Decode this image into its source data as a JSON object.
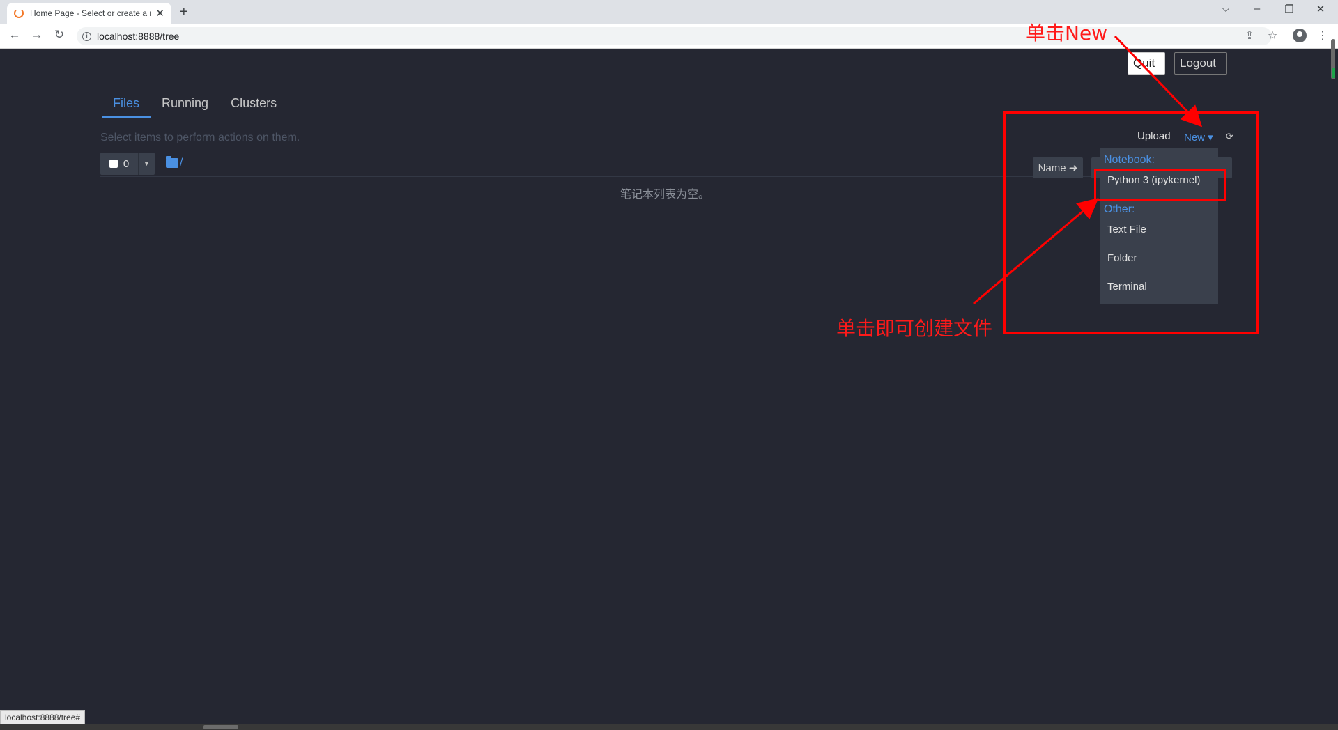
{
  "browser": {
    "tab_title": "Home Page - Select or create a notebook",
    "new_tab_icon": "plus-icon",
    "url": "localhost:8888/tree",
    "status_url": "localhost:8888/tree#"
  },
  "header": {
    "quit_label": "Quit",
    "logout_label": "Logout"
  },
  "tabs": [
    {
      "label": "Files",
      "active": true
    },
    {
      "label": "Running",
      "active": false
    },
    {
      "label": "Clusters",
      "active": false
    }
  ],
  "files": {
    "hint": "Select items to perform actions on them.",
    "selected_count": "0",
    "breadcrumb_sep": "/",
    "empty_message": "笔记本列表为空。",
    "sort_name_label": "Name ➜"
  },
  "actions": {
    "upload_label": "Upload",
    "new_label": "New ▾",
    "refresh_icon": "refresh-icon"
  },
  "new_menu": {
    "notebook_header": "Notebook:",
    "python_kernel": "Python 3 (ipykernel)",
    "other_header": "Other:",
    "text_file": "Text File",
    "folder": "Folder",
    "terminal": "Terminal"
  },
  "annotations": {
    "click_new": "单击New",
    "click_create": "单击即可创建文件",
    "color": "#ff0000"
  },
  "colors": {
    "background": "#252732",
    "accent": "#4a90e2"
  }
}
